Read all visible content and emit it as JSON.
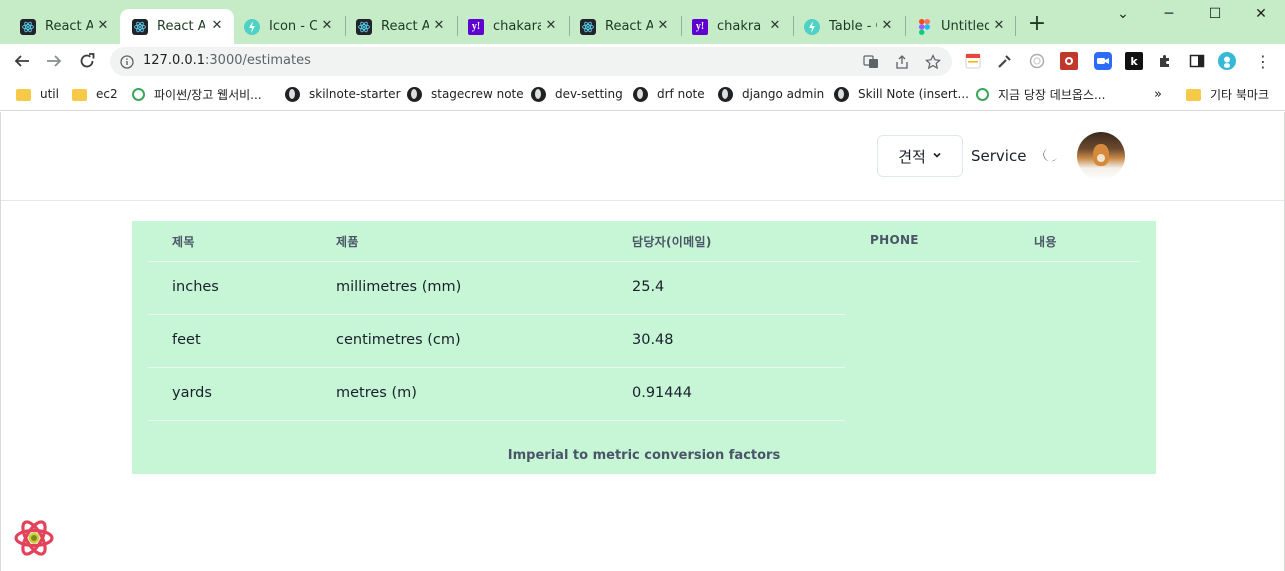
{
  "browser": {
    "tabs": [
      {
        "title": "React App",
        "icon": "react-icon",
        "active": false
      },
      {
        "title": "React App",
        "icon": "react-icon",
        "active": true
      },
      {
        "title": "Icon - Chakra UI",
        "icon": "chakra-icon",
        "active": false
      },
      {
        "title": "React App",
        "icon": "react-icon",
        "active": false
      },
      {
        "title": "chakara ui",
        "icon": "yahoo-icon",
        "active": false
      },
      {
        "title": "React App",
        "icon": "react-icon",
        "active": false
      },
      {
        "title": "chakra ui",
        "icon": "yahoo-icon",
        "active": false
      },
      {
        "title": "Table - Chakra UI",
        "icon": "chakra-icon",
        "active": false
      },
      {
        "title": "Untitled",
        "icon": "figma-icon",
        "active": false
      }
    ],
    "tab_close_glyph": "✕",
    "new_tab_glyph": "+",
    "window_controls": {
      "minimize": "⌄",
      "restore": "─",
      "maximize": "☐",
      "close": "✕"
    },
    "url": {
      "host": "127.0.0.1",
      "path": ":3000/estimates"
    },
    "bookmarks": [
      {
        "label": "util",
        "icon": "folder-icon"
      },
      {
        "label": "ec2",
        "icon": "folder-icon"
      },
      {
        "label": "파이썬/장고 웹서비...",
        "icon": "ring-icon"
      },
      {
        "label": "skilnote-starter",
        "icon": "globe-icon"
      },
      {
        "label": "stagecrew note",
        "icon": "globe-icon"
      },
      {
        "label": "dev-setting",
        "icon": "globe-icon"
      },
      {
        "label": "drf note",
        "icon": "globe-icon"
      },
      {
        "label": "django admin",
        "icon": "globe-icon"
      },
      {
        "label": "Skill Note (insert...",
        "icon": "globe-icon"
      },
      {
        "label": "지금 당장 데브옵스...",
        "icon": "ring-icon"
      }
    ],
    "bookmarks_overflow": "»",
    "other_bookmarks": "기타 북마크"
  },
  "app": {
    "menu_label": "견적",
    "service_label": "Service",
    "table": {
      "headers": [
        "제목",
        "제품",
        "담당자(이메일)",
        "PHONE",
        "내용"
      ],
      "rows": [
        [
          "inches",
          "millimetres (mm)",
          "25.4"
        ],
        [
          "feet",
          "centimetres (cm)",
          "30.48"
        ],
        [
          "yards",
          "metres (m)",
          "0.91444"
        ]
      ],
      "caption": "Imperial to metric conversion factors"
    }
  },
  "colors": {
    "tabstrip": "#c5ebc7",
    "table_bg": "#c6f6d5"
  }
}
